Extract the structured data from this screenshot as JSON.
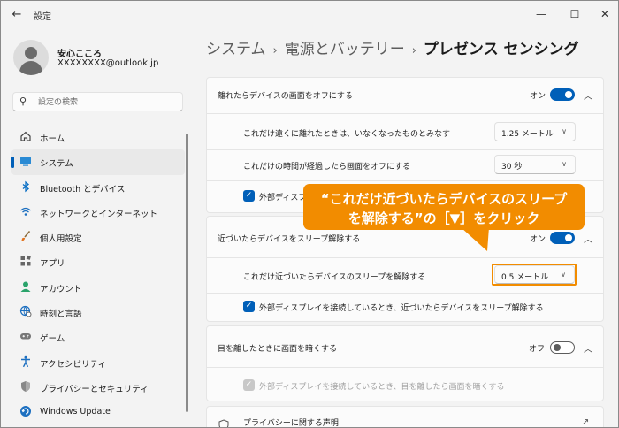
{
  "window": {
    "title": "設定"
  },
  "user": {
    "name": "安心こころ",
    "email": "XXXXXXXX@outlook.jp"
  },
  "search": {
    "placeholder": "設定の検索"
  },
  "nav": [
    {
      "label": "ホーム",
      "icon": "home-icon"
    },
    {
      "label": "システム",
      "icon": "monitor-icon",
      "active": true
    },
    {
      "label": "Bluetooth とデバイス",
      "icon": "bluetooth-icon"
    },
    {
      "label": "ネットワークとインターネット",
      "icon": "wifi-icon"
    },
    {
      "label": "個人用設定",
      "icon": "brush-icon"
    },
    {
      "label": "アプリ",
      "icon": "apps-icon"
    },
    {
      "label": "アカウント",
      "icon": "person-icon"
    },
    {
      "label": "時刻と言語",
      "icon": "globe-clock-icon"
    },
    {
      "label": "ゲーム",
      "icon": "gamepad-icon"
    },
    {
      "label": "アクセシビリティ",
      "icon": "accessibility-icon"
    },
    {
      "label": "プライバシーとセキュリティ",
      "icon": "shield-icon"
    },
    {
      "label": "Windows Update",
      "icon": "update-icon"
    }
  ],
  "breadcrumb": {
    "level1": "システム",
    "level2": "電源とバッテリー",
    "current": "プレゼンス センシング"
  },
  "sections": {
    "walk_away": {
      "title": "離れたらデバイスの画面をオフにする",
      "toggle_label": "オン",
      "distance_label": "これだけ遠くに離れたときは、いなくなったものとみなす",
      "distance_value": "1.25 メートル",
      "time_label": "これだけの時間が経過したら画面をオフにする",
      "time_value": "30 秒",
      "external_label": "外部ディスプ"
    },
    "approach": {
      "title": "近づいたらデバイスをスリープ解除する",
      "toggle_label": "オン",
      "distance_label": "これだけ近づいたらデバイスのスリープを解除する",
      "distance_value": "0.5 メートル",
      "external_label": "外部ディスプレイを接続しているとき、近づいたらデバイスをスリープ解除する"
    },
    "dim": {
      "title": "目を離したときに画面を暗くする",
      "toggle_label": "オフ",
      "external_label": "外部ディスプレイを接続しているとき、目を離したら画面を暗くする"
    },
    "privacy": {
      "label": "プライバシーに関する声明"
    }
  },
  "callout": {
    "line1": "“これだけ近づいたらデバイスのスリープ",
    "line2": "を解除する”の［▼］をクリック"
  },
  "colors": {
    "accent": "#005fb8",
    "callout": "#f28c00"
  }
}
